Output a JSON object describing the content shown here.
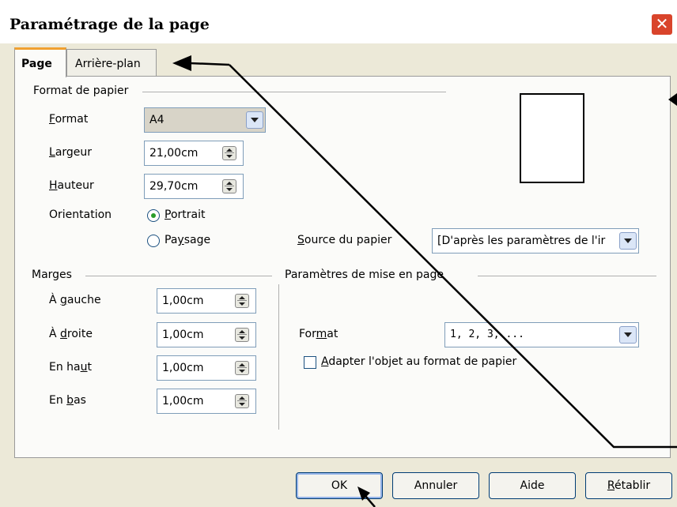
{
  "window": {
    "title": "Paramétrage de la page",
    "close_icon": "close-icon"
  },
  "tabs": [
    {
      "label": "Page",
      "active": true
    },
    {
      "label": "Arrière-plan",
      "active": false
    }
  ],
  "paper_format": {
    "section_label": "Format de papier",
    "format_label": "Format",
    "format_value": "A4",
    "width_label": "Largeur",
    "width_value": "21,00cm",
    "height_label": "Hauteur",
    "height_value": "29,70cm",
    "orientation_label": "Orientation",
    "portrait_label": "Portrait",
    "landscape_label": "Paysage",
    "orientation_selected": "Portrait",
    "source_label": "Source du papier",
    "source_value": "[D'après les paramètres de l'ir"
  },
  "margins": {
    "section_label": "Marges",
    "left_label": "À gauche",
    "left_value": "1,00cm",
    "right_label": "À droite",
    "right_value": "1,00cm",
    "top_label": "En haut",
    "top_value": "1,00cm",
    "bottom_label": "En bas",
    "bottom_value": "1,00cm"
  },
  "layout_settings": {
    "section_label": "Paramètres de mise en page",
    "format_label": "Format",
    "format_value": "1, 2, 3, ...",
    "fit_object_label": "Adapter l'objet au format de papier",
    "fit_object_checked": false
  },
  "buttons": {
    "ok": "OK",
    "cancel": "Annuler",
    "help": "Aide",
    "reset": "Rétablir"
  },
  "colors": {
    "title_close": "#d9442b",
    "active_tab_accent": "#f0a030",
    "dialog_bg": "#ece9d8"
  }
}
